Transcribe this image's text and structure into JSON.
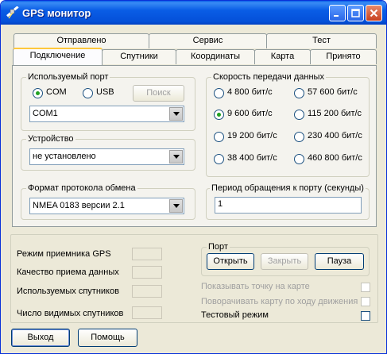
{
  "window": {
    "title": "GPS монитор",
    "controls": [
      "minimize",
      "maximize",
      "close"
    ]
  },
  "tabs": {
    "back_row": [
      "Отправлено",
      "Сервис",
      "Тест"
    ],
    "front_row": [
      "Подключение",
      "Спутники",
      "Координаты",
      "Карта",
      "Принято"
    ],
    "active": "Подключение"
  },
  "port_group": {
    "legend": "Используемый порт",
    "radio_com": "COM",
    "radio_usb": "USB",
    "selected": "COM",
    "search_button": "Поиск",
    "port_value": "COM1"
  },
  "device_group": {
    "legend": "Устройство",
    "value": "не установлено"
  },
  "protocol_group": {
    "legend": "Формат протокола обмена",
    "value": "NMEA 0183 версии 2.1"
  },
  "speed_group": {
    "legend": "Скорость передачи данных",
    "options": [
      "4 800 бит/с",
      "57 600 бит/с",
      "9 600 бит/с",
      "115 200 бит/с",
      "19 200 бит/с",
      "230 400 бит/с",
      "38 400 бит/с",
      "460 800 бит/с"
    ],
    "selected": "9 600 бит/с"
  },
  "period_group": {
    "legend": "Период обращения к порту (секунды)",
    "value": "1"
  },
  "status": {
    "labels": [
      "Режим приемника GPS",
      "Качество приема данных",
      "Используемых спутников",
      "Число видимых спутников"
    ]
  },
  "port_box": {
    "legend": "Порт",
    "open_button": "Открыть",
    "close_button": "Закрыть",
    "pause_button": "Пауза"
  },
  "options": {
    "show_on_map": "Показывать точку на карте",
    "rotate_map": "Поворачивать карту по ходу движения",
    "test_mode": "Тестовый режим"
  },
  "buttons": {
    "exit": "Выход",
    "help": "Помощь"
  }
}
